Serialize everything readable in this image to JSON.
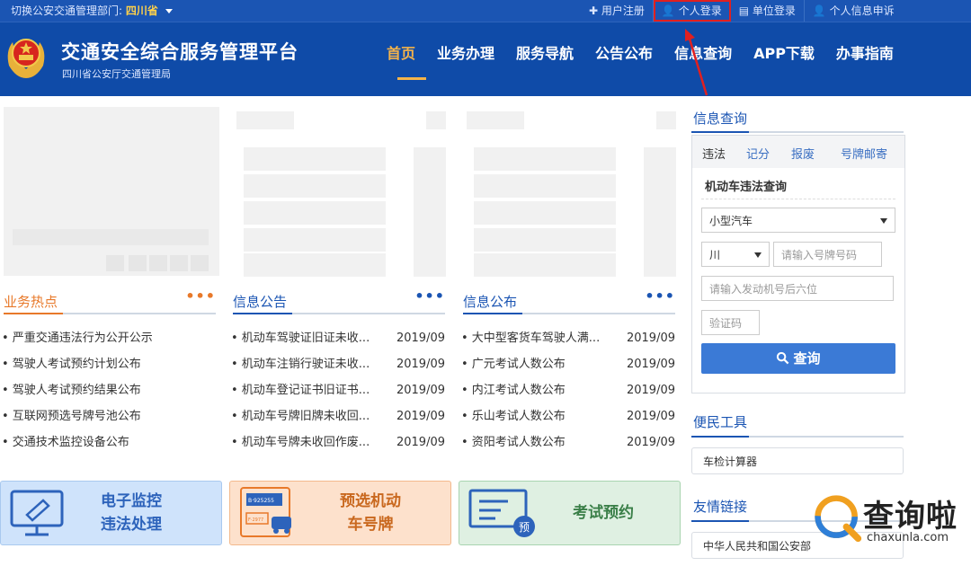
{
  "topbar": {
    "dept_prefix": "切换公安交通管理部门:",
    "dept_value": "四川省",
    "links": [
      {
        "icon": "plus-icon",
        "glyph": "✚",
        "label": "用户注册"
      },
      {
        "icon": "user-icon",
        "glyph": "👤",
        "label": "个人登录"
      },
      {
        "icon": "document-icon",
        "glyph": "▤",
        "label": "单位登录"
      },
      {
        "icon": "user-icon",
        "glyph": "👤",
        "label": "个人信息申诉"
      }
    ],
    "highlight_color": "#e02020"
  },
  "header": {
    "title": "交通安全综合服务管理平台",
    "subtitle": "四川省公安厅交通管理局",
    "nav": [
      "首页",
      "业务办理",
      "服务导航",
      "公告公布",
      "信息查询",
      "APP下载",
      "办事指南"
    ],
    "active_color": "#f4b34a",
    "brand_color": "#0f4ba8"
  },
  "sections": {
    "hot": {
      "title": "业务热点",
      "more": "•••",
      "color": "#e8792a",
      "items": [
        "• 严重交通违法行为公开公示",
        "• 驾驶人考试预约计划公布",
        "• 驾驶人考试预约结果公布",
        "• 互联网预选号牌号池公布",
        "• 交通技术监控设备公布"
      ]
    },
    "notice": {
      "title": "信息公告",
      "more": "•••",
      "color": "#1b55b3",
      "items": [
        {
          "text": "• 机动车驾驶证旧证未收...",
          "date": "2019/09"
        },
        {
          "text": "• 机动车注销行驶证未收...",
          "date": "2019/09"
        },
        {
          "text": "• 机动车登记证书旧证书...",
          "date": "2019/09"
        },
        {
          "text": "• 机动车号牌旧牌未收回...",
          "date": "2019/09"
        },
        {
          "text": "• 机动车号牌未收回作废...",
          "date": "2019/09"
        }
      ]
    },
    "publish": {
      "title": "信息公布",
      "more": "•••",
      "color": "#1b55b3",
      "items": [
        {
          "text": "• 大中型客货车驾驶人满...",
          "date": "2019/09"
        },
        {
          "text": "• 广元考试人数公布",
          "date": "2019/09"
        },
        {
          "text": "• 内江考试人数公布",
          "date": "2019/09"
        },
        {
          "text": "• 乐山考试人数公布",
          "date": "2019/09"
        },
        {
          "text": "• 资阳考试人数公布",
          "date": "2019/09"
        }
      ]
    }
  },
  "banners": {
    "monitor": {
      "line1": "电子监控",
      "line2": "违法处理",
      "icon": "monitor-icon",
      "bg": "#cfe3fb",
      "border": "#a9c9ef"
    },
    "plate": {
      "line1": "预选机动",
      "line2": "车号牌",
      "icon": "license-plate-icon",
      "plate1": "B·925255",
      "plate2": "F·2977",
      "bg": "#fde1cc",
      "border": "#f3b98c"
    },
    "exam": {
      "line1": "考试预约",
      "icon": "exam-icon",
      "badge": "预",
      "bg": "#dff0e2",
      "border": "#a9d4b0"
    }
  },
  "query": {
    "title": "信息查询",
    "tabs": [
      "违法",
      "记分",
      "报废",
      "号牌邮寄"
    ],
    "subtitle": "机动车违法查询",
    "vehicle_type": "小型汽车",
    "province": "川",
    "plate_placeholder": "请输入号牌号码",
    "engine_placeholder": "请输入发动机号后六位",
    "captcha_placeholder": "验证码",
    "button": "查询"
  },
  "tools": {
    "title": "便民工具",
    "items": [
      "车检计算器"
    ]
  },
  "links": {
    "title": "友情链接",
    "items": [
      "中华人民共和国公安部"
    ]
  },
  "watermark": {
    "text": "查询啦",
    "url": "chaxunla.com"
  }
}
